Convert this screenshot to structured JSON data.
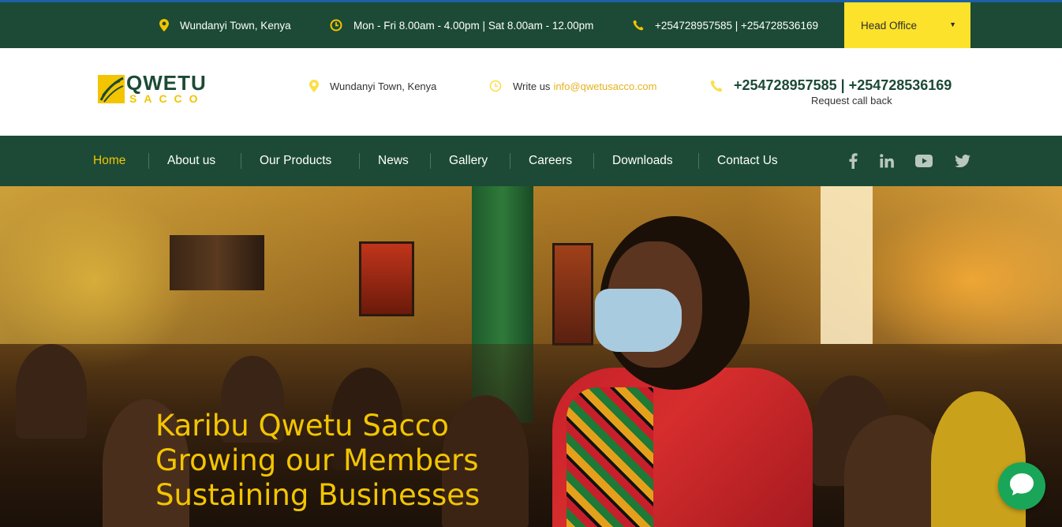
{
  "topbar": {
    "location": "Wundanyi Town, Kenya",
    "hours": "Mon - Fri 8.00am - 4.00pm | Sat 8.00am - 12.00pm",
    "phones": "+254728957585 | +254728536169",
    "branch_select": "Head Office"
  },
  "header": {
    "logo_word1": "QWETU",
    "logo_word2": "SACCO",
    "location": "Wundanyi Town, Kenya",
    "write_us_label": "Write us",
    "email": "info@qwetusacco.com",
    "phones": "+254728957585 | +254728536169",
    "callback": "Request call back"
  },
  "nav": {
    "items": [
      "Home",
      "About us",
      "Our Products",
      "News",
      "Gallery",
      "Careers",
      "Downloads",
      "Contact Us"
    ],
    "active": "Home",
    "social": [
      "facebook-icon",
      "linkedin-icon",
      "youtube-icon",
      "twitter-icon"
    ]
  },
  "hero": {
    "line1": "Karibu Qwetu Sacco",
    "line2": "Growing our Members",
    "line3": "Sustaining Businesses"
  },
  "colors": {
    "brand_green": "#1c4a36",
    "brand_yellow": "#f2c500",
    "chat_green": "#1aa658"
  }
}
